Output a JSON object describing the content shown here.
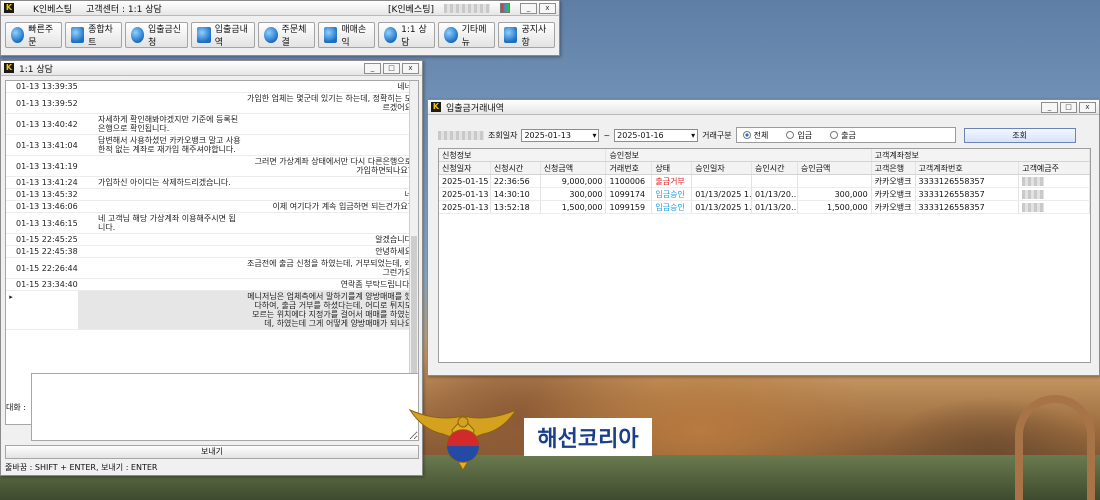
{
  "colors": {
    "accent_blue": "#1d9be0",
    "status_red": "#e02020",
    "logo_blue": "#1b3e8a"
  },
  "main_window": {
    "app_icon": "K",
    "title": "K인베스팅",
    "subtitle": "고객센터 : 1:1 상담",
    "right_label": "[K인베스팅]",
    "toolbar": [
      {
        "label": "빠른주문",
        "icon": "quick-order-icon"
      },
      {
        "label": "종합차트",
        "icon": "chart-icon"
      },
      {
        "label": "입출금신청",
        "icon": "money-request-icon"
      },
      {
        "label": "입출금내역",
        "icon": "history-icon"
      },
      {
        "label": "주문체결",
        "icon": "order-fill-icon"
      },
      {
        "label": "매매손익",
        "icon": "profit-chart-icon"
      },
      {
        "label": "1:1 상담",
        "icon": "chat-icon"
      },
      {
        "label": "기타메뉴",
        "icon": "settings-icon"
      },
      {
        "label": "공지사항",
        "icon": "megaphone-icon"
      }
    ]
  },
  "chat_window": {
    "app_icon": "K",
    "title": "1:1 상담",
    "messages": [
      {
        "time": "01-13 13:39:35",
        "left": "",
        "right": "네네",
        "sel": false
      },
      {
        "time": "01-13 13:39:52",
        "left": "",
        "right": "가입한 업체는 몇군데 있기는 하는데, 정확히는 모르겠어요",
        "sel": false
      },
      {
        "time": "01-13 13:40:42",
        "left": "자세하게 확인해봐야겠지만 기준에 등록된 은행으로 확인됩니다.",
        "right": "",
        "sel": false
      },
      {
        "time": "01-13 13:41:04",
        "left": "답변해서 사용하셨던 카카오뱅크 말고 사용한적 없는 계좌로 재가입 해주셔야합니다.",
        "right": "",
        "sel": false
      },
      {
        "time": "01-13 13:41:19",
        "left": "",
        "right": "그러면 가상계좌 상태에서만 다시 다른은행으로 가입하면되나요?",
        "sel": false
      },
      {
        "time": "01-13 13:41:24",
        "left": "가입하신 아이디는 삭제하드리겠습니다.",
        "right": "",
        "sel": false
      },
      {
        "time": "01-13 13:45:32",
        "left": "",
        "right": "네",
        "sel": false
      },
      {
        "time": "01-13 13:46:06",
        "left": "",
        "right": "이제 여기다가 계속 입금하면 되는건가요?",
        "sel": false
      },
      {
        "time": "01-13 13:46:15",
        "left": "네 고객님 해당 가상계좌 이용해주시면 됩니다.",
        "right": "",
        "sel": false
      },
      {
        "time": "01-15 22:45:25",
        "left": "",
        "right": "알겠습니다",
        "sel": false
      },
      {
        "time": "01-15 22:45:38",
        "left": "",
        "right": "안녕하세요",
        "sel": false
      },
      {
        "time": "01-15 22:26:44",
        "left": "",
        "right": "조금전에 출금 신청을 하였는데, 거부되었는데, 왜그런가요",
        "sel": false
      },
      {
        "time": "01-15 23:34:40",
        "left": "",
        "right": "연락좀 부탁드립니다.",
        "sel": false
      },
      {
        "time": "",
        "left": "",
        "right": "메니저님은 업체측에서 말하기를계 양방매매를 했다하여, 출금 거부를 하셨다는데, 어디로 튀지도 모르는 위치에다 지정가를 걸어서 매매를 하였는데, 하였는데 그게 어떻게 양방매매가 되나요",
        "sel": true
      }
    ],
    "input_label": "대화 :",
    "send_label": "보내기",
    "hint": "줄바꿈 : SHIFT + ENTER, 보내기 : ENTER"
  },
  "tx_window": {
    "title": "입출금거래내역",
    "filter": {
      "date_label": "조회일자",
      "start": "2025-01-13",
      "tilde": "~",
      "end": "2025-01-16",
      "type_label": "거래구분",
      "options": [
        "전체",
        "입금",
        "출금"
      ],
      "selected": "전체",
      "search_label": "조회"
    },
    "groups": [
      "신청정보",
      "승인정보",
      "고객계좌정보"
    ],
    "columns": [
      "신청일자",
      "신청시간",
      "신청금액",
      "거래번호",
      "상태",
      "승인일자",
      "승인시간",
      "승인금액",
      "고객은행",
      "고객계좌번호",
      "고객예금주"
    ],
    "rows": [
      {
        "date": "2025-01-15",
        "time": "22:36:56",
        "amount": "9,000,000",
        "no": "1100006",
        "status": "출금거부",
        "status_color": "#e02020",
        "adate": "",
        "atime": "",
        "aamount": "",
        "bank": "카카오뱅크",
        "account": "3333126558357"
      },
      {
        "date": "2025-01-13",
        "time": "14:30:10",
        "amount": "300,000",
        "no": "1099174",
        "status": "입금승인",
        "status_color": "#1d9be0",
        "adate": "01/13/2025 1…",
        "atime": "01/13/20…",
        "aamount": "300,000",
        "bank": "카카오뱅크",
        "account": "3333126558357"
      },
      {
        "date": "2025-01-13",
        "time": "13:52:18",
        "amount": "1,500,000",
        "no": "1099159",
        "status": "입금승인",
        "status_color": "#1d9be0",
        "adate": "01/13/2025 1…",
        "atime": "01/13/20…",
        "aamount": "1,500,000",
        "bank": "카카오뱅크",
        "account": "3333126558357"
      }
    ]
  },
  "logo": {
    "text": "해선코리아"
  }
}
